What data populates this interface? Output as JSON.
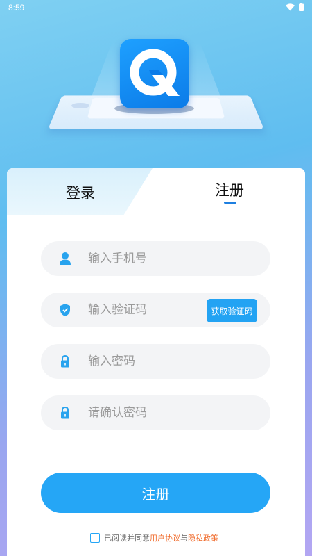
{
  "status_bar": {
    "time": "8:59",
    "icons": [
      "wifi-icon",
      "battery-icon"
    ]
  },
  "hero": {
    "logo_icon": "q-logo-icon",
    "logo_colors": [
      "#1ea0ff",
      "#0b7be8"
    ]
  },
  "tabs": {
    "login_label": "登录",
    "register_label": "注册",
    "active": "register",
    "accent_color": "#1e7fe0"
  },
  "form": {
    "phone": {
      "placeholder": "输入手机号",
      "value": "",
      "icon": "user-icon"
    },
    "code": {
      "placeholder": "输入验证码",
      "value": "",
      "icon": "shield-icon",
      "button_label": "获取验证码"
    },
    "password": {
      "placeholder": "输入密码",
      "value": "",
      "icon": "lock-icon"
    },
    "confirm_password": {
      "placeholder": "请确认密码",
      "value": "",
      "icon": "lock-icon"
    }
  },
  "submit": {
    "label": "注册",
    "color": "#25a6f6"
  },
  "agreement": {
    "checked": false,
    "prefix": "已阅读并同意",
    "user_agreement": "用户协议",
    "conjunction": "与",
    "privacy_policy": "隐私政策",
    "link_color": "#f06a2a"
  }
}
